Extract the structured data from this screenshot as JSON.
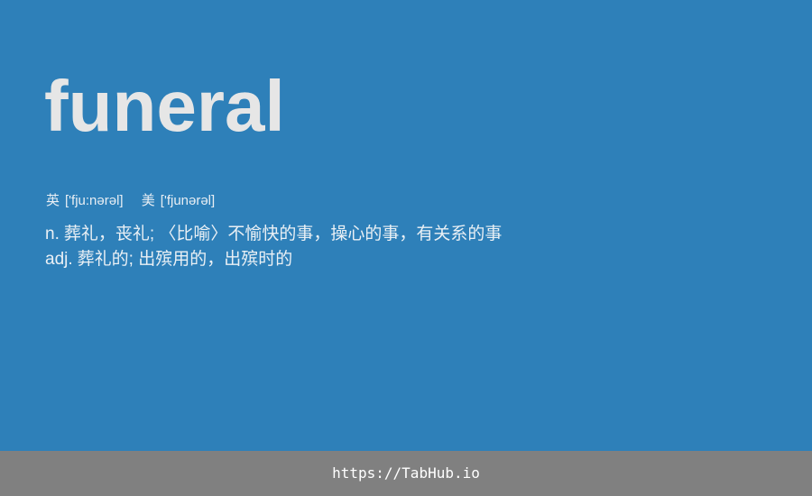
{
  "entry": {
    "word": "funeral",
    "phonetics": [
      {
        "region": "英",
        "ipa": "['fju:nərəl]"
      },
      {
        "region": "美",
        "ipa": "['fjunərəl]"
      }
    ],
    "definitions": [
      {
        "pos": "n.",
        "text": "葬礼，丧礼; 〈比喻〉不愉快的事，操心的事，有关系的事"
      },
      {
        "pos": "adj.",
        "text": "葬礼的; 出殡用的，出殡时的"
      }
    ]
  },
  "footer": {
    "url": "https://TabHub.io"
  },
  "colors": {
    "background": "#2e80b9",
    "word": "#e6e6e6",
    "text": "#eaf0f5",
    "footer_background": "#808080",
    "footer_text": "#ffffff"
  }
}
